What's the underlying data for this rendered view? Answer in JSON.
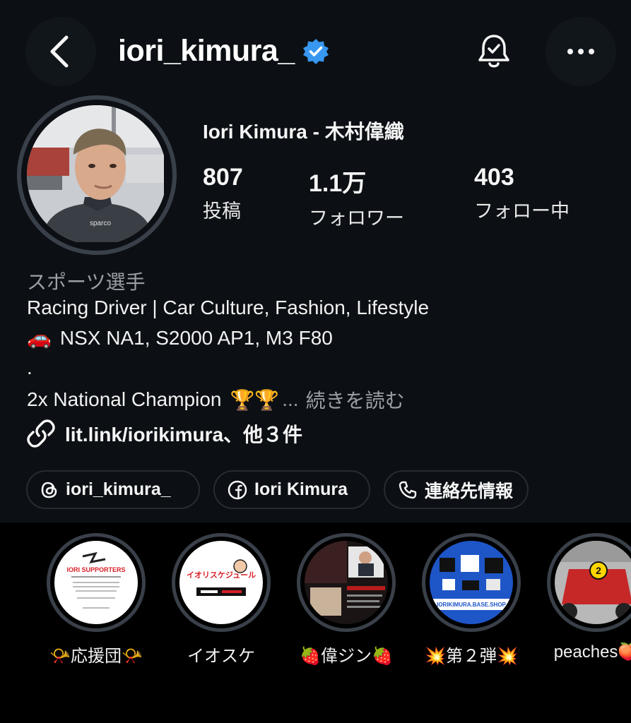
{
  "header": {
    "username": "iori_kimura_",
    "back_icon": "chevron-left-icon",
    "verified_icon": "verified-badge-icon",
    "bell_icon": "bell-check-icon",
    "more_icon": "more-horizontal-icon",
    "accent_color": "#3897f0"
  },
  "profile": {
    "full_name": "Iori Kimura - 木村偉織",
    "stats": [
      {
        "value": "807",
        "label": "投稿"
      },
      {
        "value": "1.1万",
        "label": "フォロワー"
      },
      {
        "value": "403",
        "label": "フォロー中"
      }
    ]
  },
  "bio": {
    "category": "スポーツ選手",
    "line1": "Racing Driver | Car Culture, Fashion, Lifestyle",
    "line2_emoji": "🚗",
    "line2": "NSX NA1, S2000 AP1, M3 F80",
    "line3": ".",
    "line4": "2x National Champion",
    "line4_emoji": "🏆🏆",
    "ellipsis": "...",
    "read_more": "続きを読む",
    "link_text": "lit.link/iorikimura、他３件"
  },
  "chips": [
    {
      "icon": "threads-icon",
      "label": "iori_kimura_"
    },
    {
      "icon": "facebook-icon",
      "label": "Iori Kimura"
    },
    {
      "icon": "phone-icon",
      "label": "連絡先情報"
    }
  ],
  "highlights": [
    {
      "label": "📯応援団📯",
      "art_title": "IORI SUPPORTERS"
    },
    {
      "label": "イオスケ",
      "art_title": "イオリスケジュール"
    },
    {
      "label": "🍓偉ジン🍓",
      "art_title": ""
    },
    {
      "label": "💥第２弾💥",
      "art_title": "IORIKIMURA.BASE.SHOP"
    },
    {
      "label": "peaches🍑",
      "art_title": ""
    }
  ]
}
